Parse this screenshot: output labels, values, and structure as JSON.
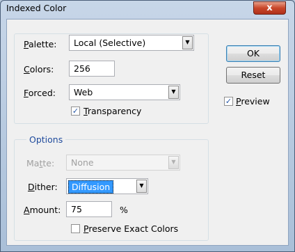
{
  "window": {
    "title": "Indexed Color",
    "close_glyph": "x"
  },
  "palette": {
    "label_u": "P",
    "label_rest": "alette:",
    "value": "Local (Selective)"
  },
  "colors": {
    "label_u": "C",
    "label_rest": "olors:",
    "value": "256"
  },
  "forced": {
    "label_u": "F",
    "label_rest": "orced:",
    "value": "Web"
  },
  "transparency": {
    "label_u": "T",
    "label_rest": "ransparency",
    "checked": true
  },
  "options": {
    "legend": "Options",
    "matte": {
      "label_pre": "Ma",
      "label_u": "t",
      "label_rest": "te:",
      "value": "None"
    },
    "dither": {
      "label_u": "D",
      "label_rest": "ither:",
      "value": "Diffusion"
    },
    "amount": {
      "label_u": "A",
      "label_rest": "mount:",
      "value": "75",
      "unit": "%"
    },
    "preserve": {
      "label_u": "P",
      "label_rest": "reserve Exact Colors",
      "checked": false
    }
  },
  "buttons": {
    "ok": "OK",
    "reset": "Reset"
  },
  "preview": {
    "label_u": "P",
    "label_rest": "review",
    "checked": true
  },
  "glyphs": {
    "check": "✓",
    "arrow": "▼"
  }
}
